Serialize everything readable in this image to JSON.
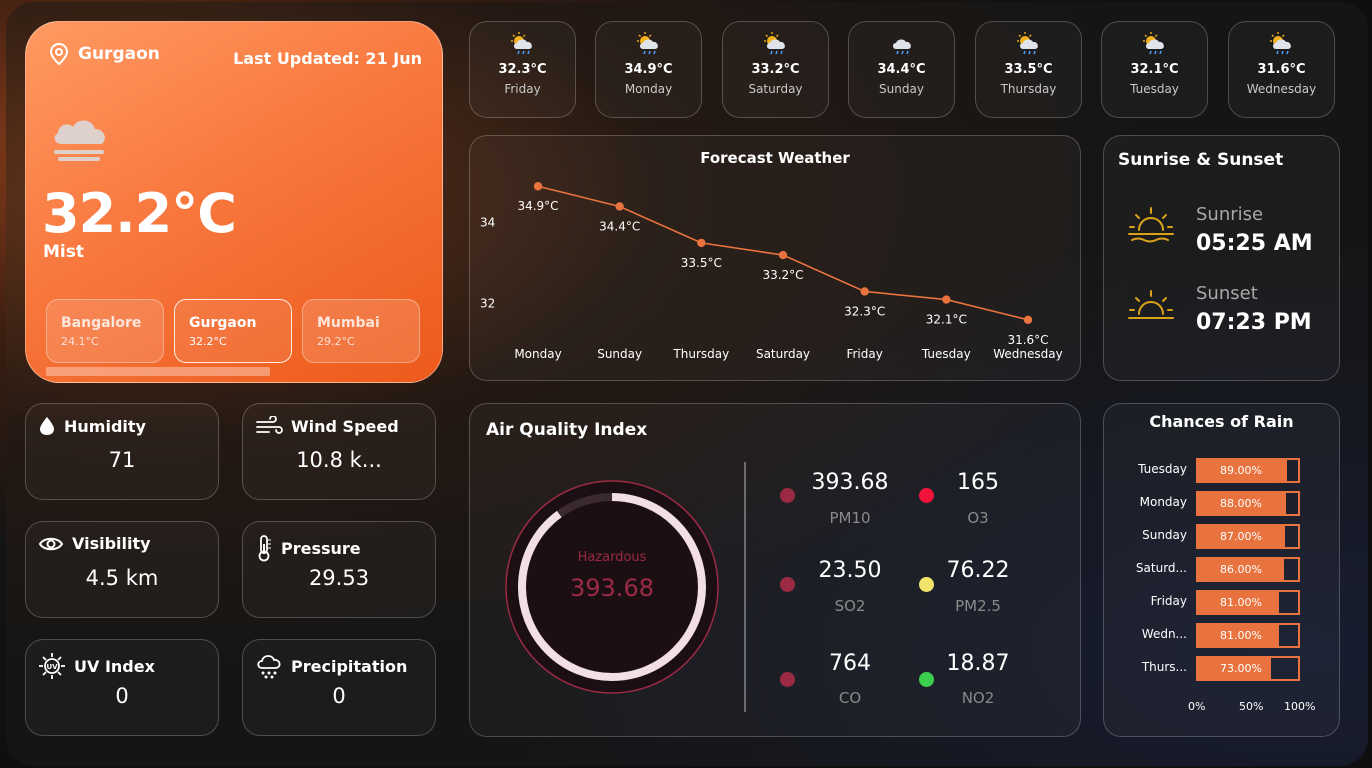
{
  "main": {
    "location": "Gurgaon",
    "last_updated": "Last Updated: 21 Jun",
    "temperature": "32.2°C",
    "condition": "Mist",
    "cities": [
      {
        "name": "Bangalore",
        "temp": "24.1°C"
      },
      {
        "name": "Gurgaon",
        "temp": "32.2°C"
      },
      {
        "name": "Mumbai",
        "temp": "29.2°C"
      }
    ]
  },
  "metrics": {
    "humidity": {
      "label": "Humidity",
      "value": "71"
    },
    "wind": {
      "label": "Wind Speed",
      "value": "10.8 k..."
    },
    "visibility": {
      "label": "Visibility",
      "value": "4.5 km"
    },
    "pressure": {
      "label": "Pressure",
      "value": "29.53"
    },
    "uv": {
      "label": "UV Index",
      "value": "0"
    },
    "precip": {
      "label": "Precipitation",
      "value": "0"
    }
  },
  "days": [
    {
      "temp": "32.3°C",
      "day": "Friday",
      "icon": "sun-cloud-rain-icon"
    },
    {
      "temp": "34.9°C",
      "day": "Monday",
      "icon": "sun-cloud-rain-icon"
    },
    {
      "temp": "33.2°C",
      "day": "Saturday",
      "icon": "sun-cloud-rain-icon"
    },
    {
      "temp": "34.4°C",
      "day": "Sunday",
      "icon": "cloud-rain-icon"
    },
    {
      "temp": "33.5°C",
      "day": "Thursday",
      "icon": "sun-cloud-rain-icon"
    },
    {
      "temp": "32.1°C",
      "day": "Tuesday",
      "icon": "sun-cloud-rain-icon"
    },
    {
      "temp": "31.6°C",
      "day": "Wednesday",
      "icon": "sun-cloud-rain-icon"
    }
  ],
  "forecast": {
    "title": "Forecast Weather"
  },
  "chart_data": [
    {
      "type": "line",
      "title": "Forecast Weather",
      "categories": [
        "Monday",
        "Sunday",
        "Thursday",
        "Saturday",
        "Friday",
        "Tuesday",
        "Wednesday"
      ],
      "values": [
        34.9,
        34.4,
        33.5,
        33.2,
        32.3,
        32.1,
        31.6
      ],
      "value_labels": [
        "34.9°C",
        "34.4°C",
        "33.5°C",
        "33.2°C",
        "32.3°C",
        "32.1°C",
        "31.6°C"
      ],
      "yticks": [
        "34",
        "32"
      ],
      "ylim": [
        31.2,
        35.4
      ],
      "color": "#e8733f"
    },
    {
      "type": "bar",
      "title": "Chances of Rain",
      "categories": [
        "Tuesday",
        "Monday",
        "Sunday",
        "Saturd...",
        "Friday",
        "Wedn...",
        "Thurs..."
      ],
      "values": [
        89,
        88,
        87,
        86,
        81,
        81,
        73
      ],
      "value_labels": [
        "89.00%",
        "88.00%",
        "87.00%",
        "86.00%",
        "81.00%",
        "81.00%",
        "73.00%"
      ],
      "xticks": [
        "0%",
        "50%",
        "100%"
      ],
      "xlim": [
        0,
        100
      ],
      "color": "#e8733f"
    }
  ],
  "sun": {
    "title": "Sunrise & Sunset",
    "sunrise_label": "Sunrise",
    "sunrise": "05:25 AM",
    "sunset_label": "Sunset",
    "sunset": "07:23 PM",
    "icon_color": "#d9a21b"
  },
  "aqi": {
    "title": "Air Quality Index",
    "status": "Hazardous",
    "value": "393.68",
    "gauge_fraction": 0.9,
    "pollutants": [
      {
        "value": "393.68",
        "name": "PM10",
        "color": "#9b2a45"
      },
      {
        "value": "165",
        "name": "O3",
        "color": "#f2123a"
      },
      {
        "value": "23.50",
        "name": "SO2",
        "color": "#9b2a45"
      },
      {
        "value": "76.22",
        "name": "PM2.5",
        "color": "#f2e46a"
      },
      {
        "value": "764",
        "name": "CO",
        "color": "#9b2a45"
      },
      {
        "value": "18.87",
        "name": "NO2",
        "color": "#3ccf4e"
      }
    ]
  },
  "rain": {
    "title": "Chances of Rain"
  }
}
